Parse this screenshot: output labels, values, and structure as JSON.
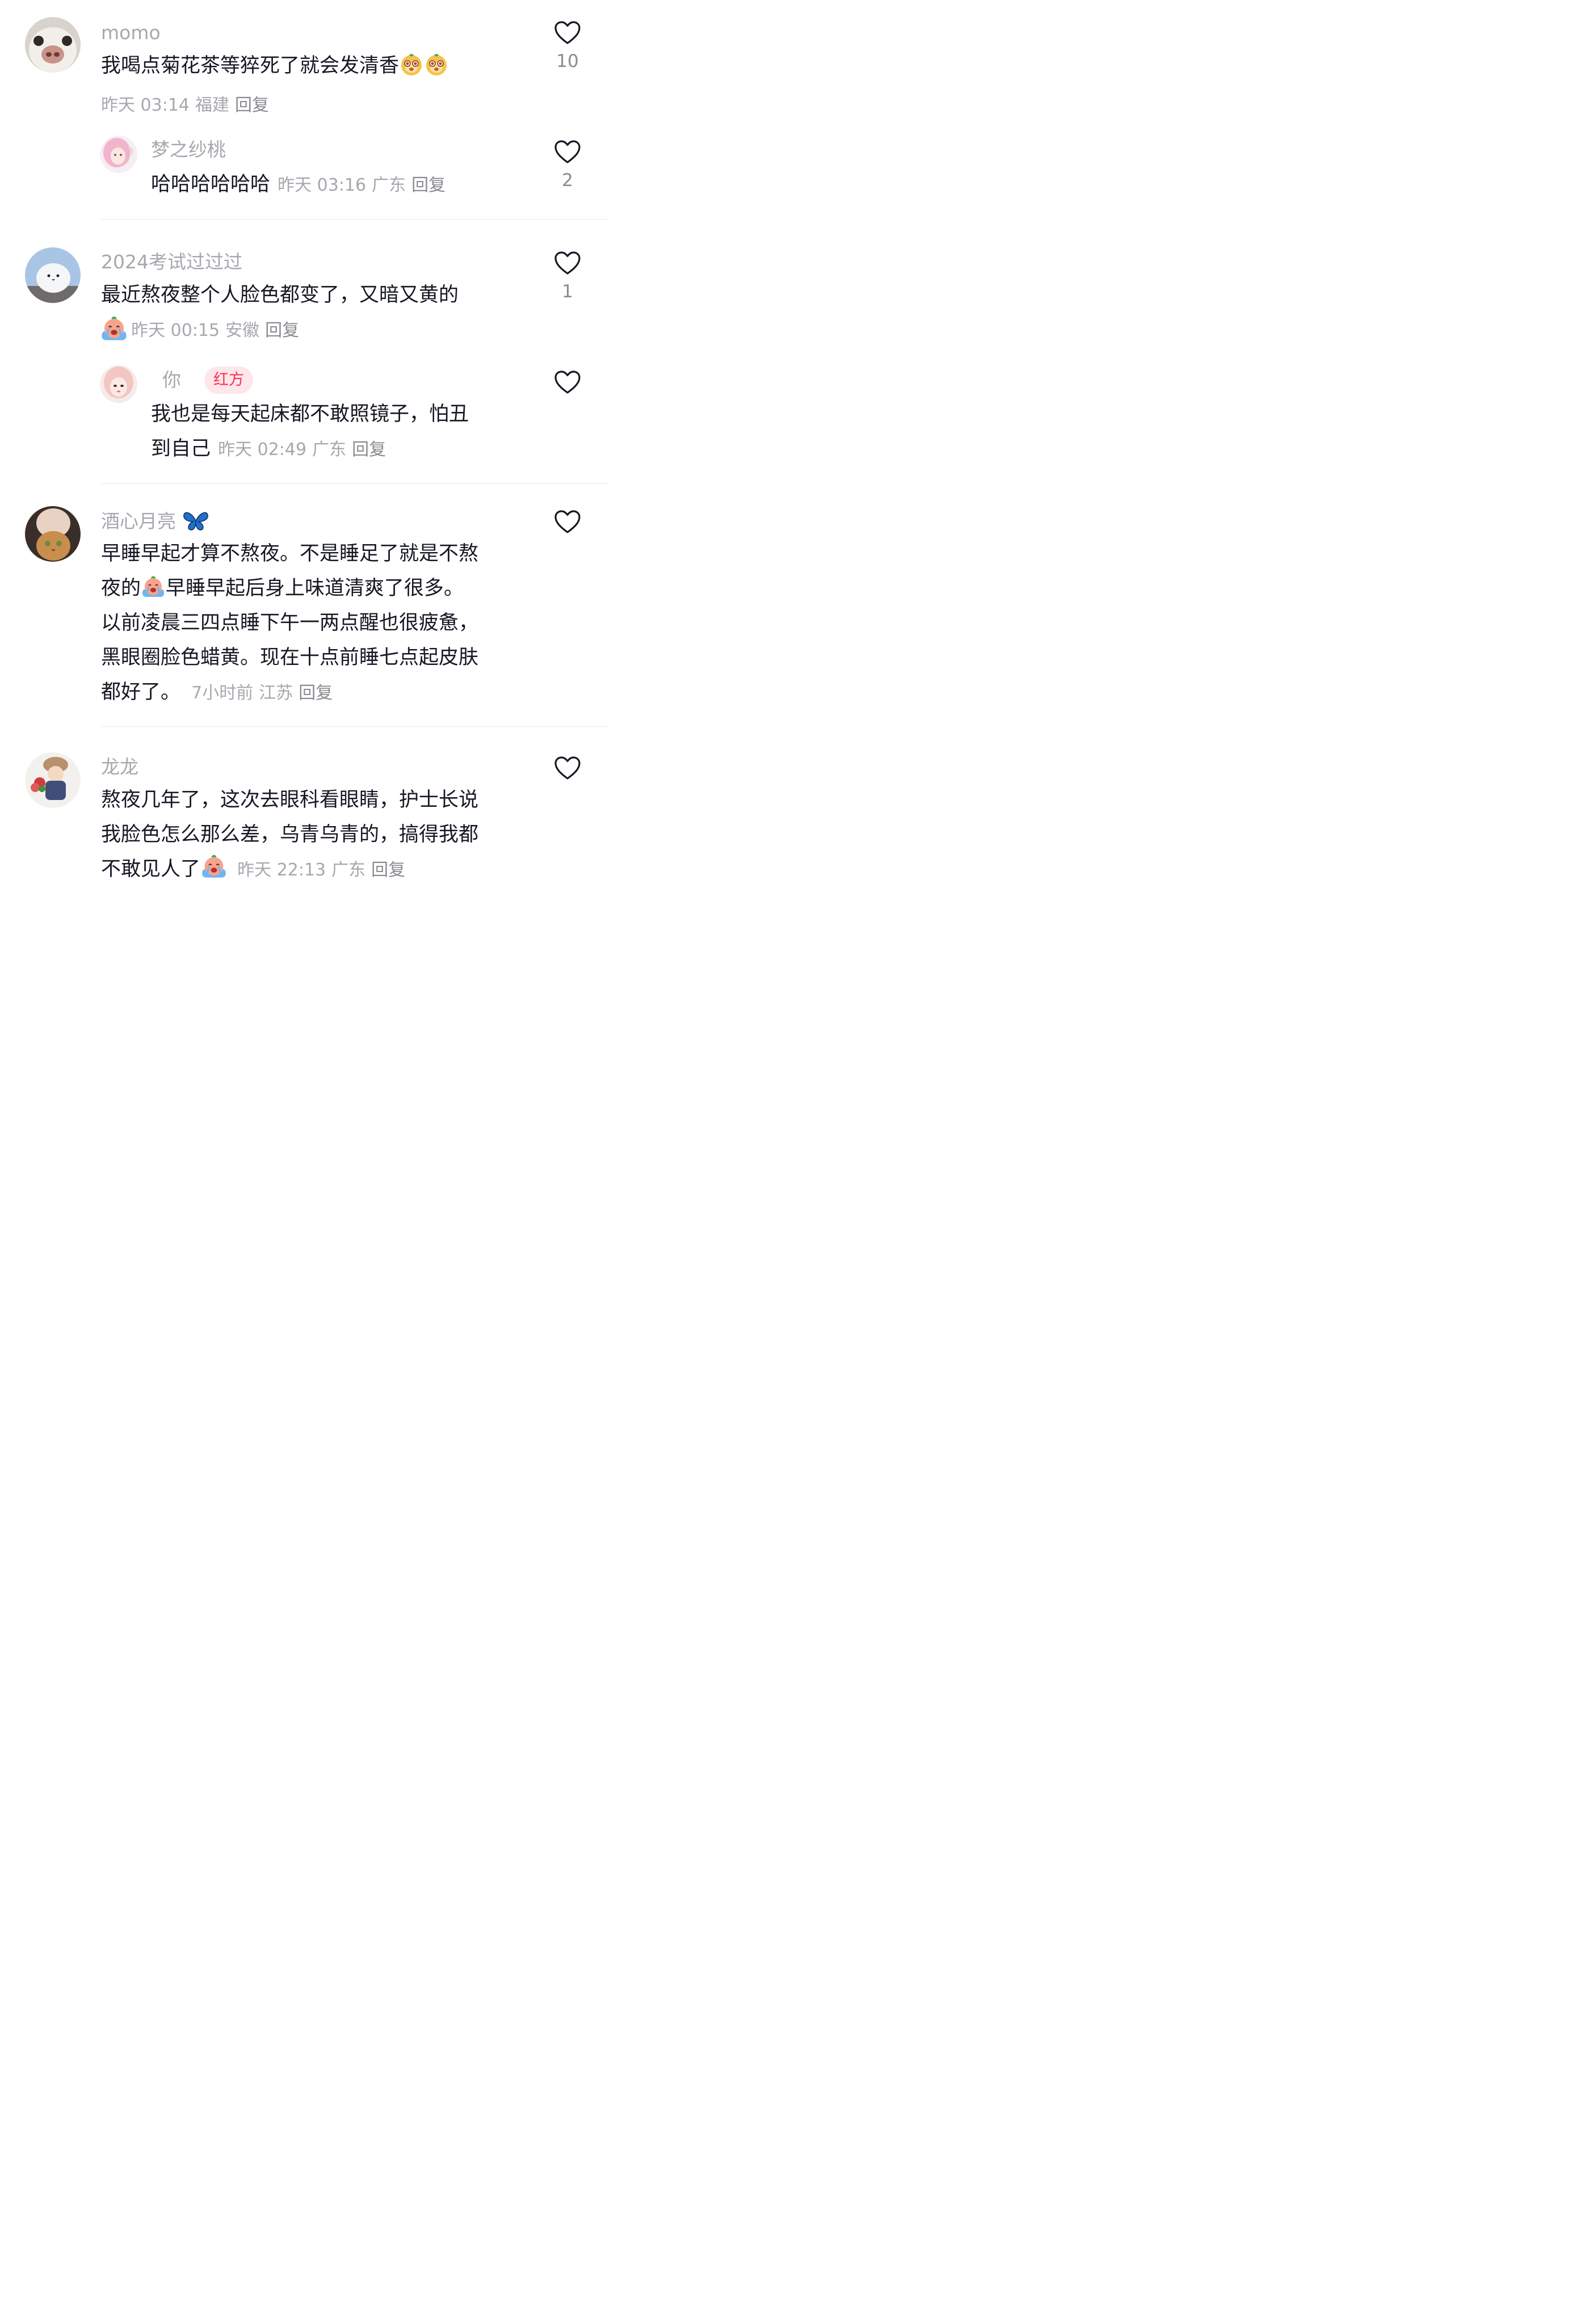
{
  "comments": [
    {
      "user": "momo",
      "text": "我喝点菊花茶等猝死了就会发清香",
      "emojis": [
        "monkey-face-emoji",
        "monkey-face-emoji"
      ],
      "time": "昨天 03:14",
      "location": "福建",
      "reply": "回复",
      "likes": "10",
      "sub": {
        "user": "梦之纱桃",
        "text": "哈哈哈哈哈哈",
        "time": "昨天 03:16",
        "location": "广东",
        "reply": "回复",
        "likes": "2"
      }
    },
    {
      "user": "2024考试过过过",
      "text": "最近熬夜整个人脸色都变了，又暗又黄的",
      "emojis": [
        "crying-face-emoji"
      ],
      "time": "昨天 00:15",
      "location": "安徽",
      "reply": "回复",
      "likes": "1",
      "sub": {
        "user": "你",
        "tag": "红方",
        "text_line1": "我也是每天起床都不敢照镜子，怕丑",
        "text_line2": "到自己",
        "time": "昨天 02:49",
        "location": "广东",
        "reply": "回复"
      }
    },
    {
      "user": "酒心月亮",
      "user_icon": "butterfly-icon",
      "line1": "早睡早起才算不熬夜。不是睡足了就是不熬",
      "line2a": "夜的",
      "line2b": "早睡早起后身上味道清爽了很多。",
      "line3": "以前凌晨三四点睡下午一两点醒也很疲惫，",
      "line4": "黑眼圈脸色蜡黄。现在十点前睡七点起皮肤",
      "line5": "都好了。",
      "emojis": [
        "crying-face-emoji"
      ],
      "time": "7小时前",
      "location": "江苏",
      "reply": "回复"
    },
    {
      "user": "龙龙",
      "line1": "熬夜几年了，这次去眼科看眼睛，护士长说",
      "line2": "我脸色怎么那么差，乌青乌青的，搞得我都",
      "line3": "不敢见人了",
      "emojis": [
        "crying-face-emoji"
      ],
      "time": "昨天 22:13",
      "location": "广东",
      "reply": "回复"
    }
  ],
  "icons": {
    "like": "heart-outline-icon"
  },
  "colors": {
    "text": "#161823",
    "meta": "#a6a8ae",
    "tag_bg": "#fde7ea",
    "tag_text": "#fe2c55"
  }
}
